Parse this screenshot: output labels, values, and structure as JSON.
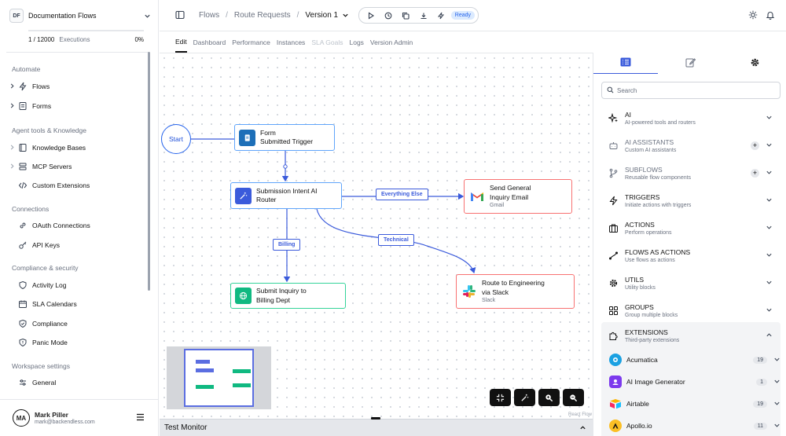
{
  "sidebar": {
    "org_badge": "DF",
    "org_name": "Documentation Flows",
    "executions_count": "1 / 12000",
    "executions_label": "Executions",
    "executions_percent": "0%",
    "executions_fraction": 0.0,
    "sections": {
      "automate": "Automate",
      "agent": "Agent tools & Knowledge",
      "connections": "Connections",
      "compliance": "Compliance & security",
      "workspace": "Workspace settings"
    },
    "items": {
      "flows": "Flows",
      "forms": "Forms",
      "knowledge_bases": "Knowledge Bases",
      "mcp_servers": "MCP Servers",
      "custom_extensions": "Custom Extensions",
      "oauth": "OAuth Connections",
      "api_keys": "API Keys",
      "activity_log": "Activity Log",
      "sla_calendars": "SLA Calendars",
      "compliance": "Compliance",
      "panic_mode": "Panic Mode",
      "general": "General"
    },
    "user": {
      "initials": "MA",
      "name": "Mark Piller",
      "email": "mark@backendless.com"
    }
  },
  "header": {
    "crumb_flows": "Flows",
    "crumb_route": "Route Requests",
    "crumb_version": "Version 1",
    "status": "Ready"
  },
  "tabs": {
    "edit": "Edit",
    "dashboard": "Dashboard",
    "performance": "Performance",
    "instances": "Instances",
    "sla_goals": "SLA Goals",
    "logs": "Logs",
    "version_admin": "Version Admin"
  },
  "canvas": {
    "start": "Start",
    "node_trigger": {
      "line1": "Form",
      "line2": "Submitted Trigger"
    },
    "node_router": {
      "line1": "Submission Intent AI",
      "line2": "Router"
    },
    "node_gmail": {
      "line1": "Send General",
      "line2": "Inquiry Email",
      "sub": "Gmail"
    },
    "node_billing": {
      "line1": "Submit Inquiry to",
      "line2": "Billing Dept"
    },
    "node_slack": {
      "line1": "Route to Engineering",
      "line2": "via Slack",
      "sub": "Slack"
    },
    "edge_everything_else": "Everything Else",
    "edge_billing": "Billing",
    "edge_technical": "Technical",
    "attribution": "React Flow"
  },
  "monitor": {
    "title": "Test Monitor"
  },
  "rpanel": {
    "search_placeholder": "Search",
    "categories": {
      "ai": {
        "title": "AI",
        "desc": "AI-powered tools and routers"
      },
      "ai_assistants": {
        "title": "AI ASSISTANTS",
        "desc": "Custom AI assistants"
      },
      "subflows": {
        "title": "SUBFLOWS",
        "desc": "Reusable flow components"
      },
      "triggers": {
        "title": "TRIGGERS",
        "desc": "Initiate actions with triggers"
      },
      "actions": {
        "title": "ACTIONS",
        "desc": "Perform operations"
      },
      "flows_as_actions": {
        "title": "FLOWS AS ACTIONS",
        "desc": "Use flows as actions"
      },
      "utils": {
        "title": "UTILS",
        "desc": "Utility blocks"
      },
      "groups": {
        "title": "GROUPS",
        "desc": "Group multiple blocks"
      },
      "extensions": {
        "title": "EXTENSIONS",
        "desc": "Third-party extensions"
      }
    },
    "extensions": [
      {
        "name": "Acumatica",
        "count": "19"
      },
      {
        "name": "AI Image Generator",
        "count": "1"
      },
      {
        "name": "Airtable",
        "count": "19"
      },
      {
        "name": "Apollo.io",
        "count": "11"
      }
    ]
  },
  "colors": {
    "accent": "#3b5bdb",
    "node_border_blue": "#60a5fa",
    "node_border_red": "#f87171",
    "node_border_green": "#34d399",
    "ready_bg": "#dbeafe"
  }
}
